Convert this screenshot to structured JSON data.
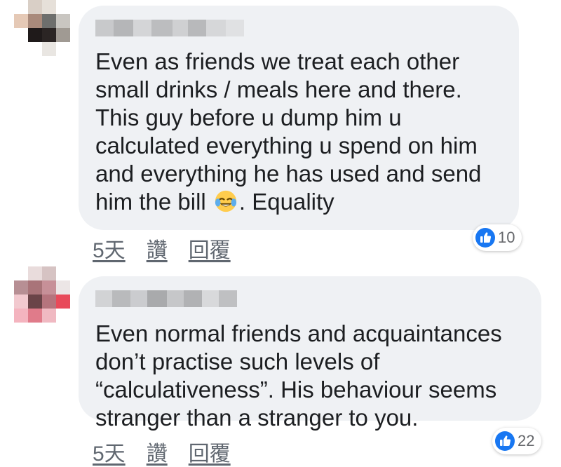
{
  "colors": {
    "bubble": "#eff1f4",
    "text": "#1c1e21",
    "meta": "#606770",
    "like_blue": "#1877f2"
  },
  "comments": [
    {
      "text": "Even as friends we treat each other\nsmall drinks / meals here and there.\nThis guy before u dump him u\ncalculated everything u spend on him\nand everything he has used and send\nhim the bill",
      "text_tail": ". Equality",
      "emoji": "face-with-tears-of-joy-icon",
      "timestamp": "5天",
      "like_label": "讚",
      "reply_label": "回覆",
      "reaction_icon": "thumbs-up-icon",
      "reaction_count": "10"
    },
    {
      "text": "Even normal friends and acquaintances\ndon’t practise such levels of\n“calculativeness”. His behaviour seems\nstranger than a stranger to you.",
      "timestamp": "5天",
      "like_label": "讚",
      "reply_label": "回覆",
      "reaction_icon": "thumbs-up-icon",
      "reaction_count": "22"
    }
  ]
}
